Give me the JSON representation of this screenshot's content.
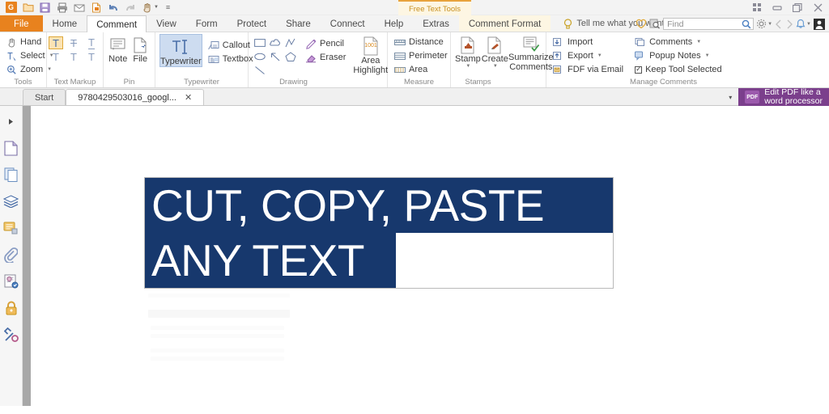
{
  "titlebar": {
    "app_logo": "G",
    "quick_access": [
      {
        "name": "open-file-icon",
        "glyph": "📁"
      },
      {
        "name": "save-icon",
        "glyph": "💾"
      },
      {
        "name": "print-icon",
        "glyph": "🖨"
      },
      {
        "name": "email-icon",
        "glyph": "✉"
      },
      {
        "name": "new-from-file-icon",
        "glyph": "📄"
      },
      {
        "name": "undo-icon",
        "glyph": "↶"
      },
      {
        "name": "redo-icon",
        "glyph": "↷"
      },
      {
        "name": "hand-tool-icon",
        "glyph": "✋"
      }
    ],
    "customize_glyph": "≡",
    "contextual_tab": "Free Text Tools",
    "window_controls": [
      {
        "name": "apps-grid-icon",
        "glyph": "∷"
      },
      {
        "name": "minimize-icon",
        "glyph": "–"
      },
      {
        "name": "restore-icon",
        "glyph": "❐"
      },
      {
        "name": "close-icon",
        "glyph": "✕"
      }
    ]
  },
  "menu": {
    "tabs": [
      {
        "label": "File",
        "style": "file"
      },
      {
        "label": "Home",
        "style": "normal"
      },
      {
        "label": "Comment",
        "style": "active"
      },
      {
        "label": "View",
        "style": "normal"
      },
      {
        "label": "Form",
        "style": "normal"
      },
      {
        "label": "Protect",
        "style": "normal"
      },
      {
        "label": "Share",
        "style": "normal"
      },
      {
        "label": "Connect",
        "style": "normal"
      },
      {
        "label": "Help",
        "style": "normal"
      },
      {
        "label": "Extras",
        "style": "normal"
      },
      {
        "label": "Comment Format",
        "style": "cmtfmt"
      }
    ],
    "tell_me": "Tell me what you want to do..",
    "find_placeholder": "Find",
    "right_icons": [
      {
        "name": "favorites-heart-icon",
        "glyph": "♡"
      },
      {
        "name": "search-document-icon",
        "glyph": "🔍"
      }
    ],
    "trailing_icons": [
      {
        "name": "settings-gear-icon",
        "glyph": "⚙"
      },
      {
        "name": "navigate-back-icon",
        "glyph": "◁"
      },
      {
        "name": "navigate-forward-icon",
        "glyph": "▷"
      },
      {
        "name": "notifications-bell-icon",
        "glyph": "🔔"
      },
      {
        "name": "account-avatar-icon",
        "glyph": "👤"
      }
    ]
  },
  "ribbon": {
    "groups": [
      {
        "label": "Tools",
        "items": [
          {
            "label": "Hand",
            "icon": "hand-icon",
            "glyph": "✋",
            "dropdown": false
          },
          {
            "label": "Select",
            "icon": "select-text-icon",
            "glyph": "T",
            "dropdown": true
          },
          {
            "label": "Zoom",
            "icon": "zoom-icon",
            "glyph": "🔍",
            "dropdown": true
          }
        ]
      },
      {
        "label": "Text Markup",
        "icons": [
          {
            "name": "highlight-text-icon",
            "glyph": "T",
            "selected": true
          },
          {
            "name": "strikeout-text-icon",
            "glyph": "T",
            "selected": false
          },
          {
            "name": "underline-text-icon",
            "glyph": "T",
            "selected": false
          },
          {
            "name": "squiggly-underline-icon",
            "glyph": "T",
            "selected": false
          },
          {
            "name": "replace-text-icon",
            "glyph": "T",
            "selected": false
          },
          {
            "name": "insert-text-icon",
            "glyph": "T",
            "selected": false
          }
        ]
      },
      {
        "label": "Pin",
        "buttons": [
          {
            "label": "Note",
            "icon": "note-icon"
          },
          {
            "label": "File",
            "icon": "file-attach-icon"
          }
        ]
      },
      {
        "label": "Typewriter",
        "main": {
          "label": "Typewriter",
          "icon": "typewriter-icon",
          "selected": true
        },
        "items": [
          {
            "label": "Callout",
            "icon": "callout-icon"
          },
          {
            "label": "Textbox",
            "icon": "textbox-icon"
          }
        ]
      },
      {
        "label": "Drawing",
        "shapes": [
          {
            "name": "rectangle-shape-icon"
          },
          {
            "name": "cloud-shape-icon"
          },
          {
            "name": "polyline-shape-icon"
          },
          {
            "name": "ellipse-shape-icon"
          },
          {
            "name": "arrow-shape-icon"
          },
          {
            "name": "polygon-shape-icon"
          },
          {
            "name": "line-shape-icon"
          }
        ],
        "items": [
          {
            "label": "Pencil",
            "icon": "pencil-icon"
          },
          {
            "label": "Eraser",
            "icon": "eraser-icon"
          }
        ],
        "big": {
          "label1": "Area",
          "label2": "Highlight",
          "icon": "area-highlight-icon"
        }
      },
      {
        "label": "Measure",
        "items": [
          {
            "label": "Distance",
            "icon": "distance-icon"
          },
          {
            "label": "Perimeter",
            "icon": "perimeter-icon"
          },
          {
            "label": "Area",
            "icon": "area-icon"
          }
        ]
      },
      {
        "label": "Stamps",
        "buttons": [
          {
            "label": "Stamp",
            "icon": "stamp-icon",
            "dropdown": true
          },
          {
            "label": "Create",
            "icon": "create-stamp-icon",
            "dropdown": true
          },
          {
            "label1": "Summarize",
            "label2": "Comments",
            "icon": "summarize-comments-icon"
          }
        ]
      },
      {
        "label": "Manage Comments",
        "col1": [
          {
            "label": "Import",
            "icon": "import-icon",
            "dropdown": false
          },
          {
            "label": "Export",
            "icon": "export-icon",
            "dropdown": true
          },
          {
            "label": "FDF via Email",
            "icon": "fdf-email-icon",
            "dropdown": false
          }
        ],
        "col2": [
          {
            "label": "Comments",
            "icon": "comments-icon",
            "dropdown": true
          },
          {
            "label": "Popup Notes",
            "icon": "popup-notes-icon",
            "dropdown": true
          },
          {
            "label": "Keep Tool Selected",
            "icon": "checkbox-icon",
            "checked": true
          }
        ]
      }
    ]
  },
  "doctabs": {
    "tabs": [
      {
        "label": "Start",
        "active": false,
        "closable": false
      },
      {
        "label": "9780429503016_googl...",
        "active": true,
        "closable": true,
        "close_glyph": "✕"
      }
    ],
    "collapse_glyph": "▾",
    "promo": {
      "line1": "Edit PDF like a",
      "line2": "word processor",
      "icon_text": "PDF"
    }
  },
  "sidebar": {
    "items": [
      {
        "name": "expand-panel-icon",
        "glyph": "▶"
      },
      {
        "name": "page-thumbnails-icon",
        "glyph": "📄"
      },
      {
        "name": "organize-pages-icon",
        "glyph": "📑"
      },
      {
        "name": "layers-icon",
        "glyph": "≣"
      },
      {
        "name": "comments-panel-icon",
        "glyph": "💬"
      },
      {
        "name": "attachments-icon",
        "glyph": "📎"
      },
      {
        "name": "digital-signature-icon",
        "glyph": "📝"
      },
      {
        "name": "security-lock-icon",
        "glyph": "🔒"
      },
      {
        "name": "tools-icon",
        "glyph": "🔧"
      }
    ]
  },
  "document": {
    "text_lines": [
      {
        "text": "CUT, COPY, PASTE",
        "highlight_width": 580
      },
      {
        "text": "ANY TEXT",
        "highlight_width": 312
      }
    ],
    "selection_color": "#17386d",
    "text_color": "#ffffff"
  }
}
